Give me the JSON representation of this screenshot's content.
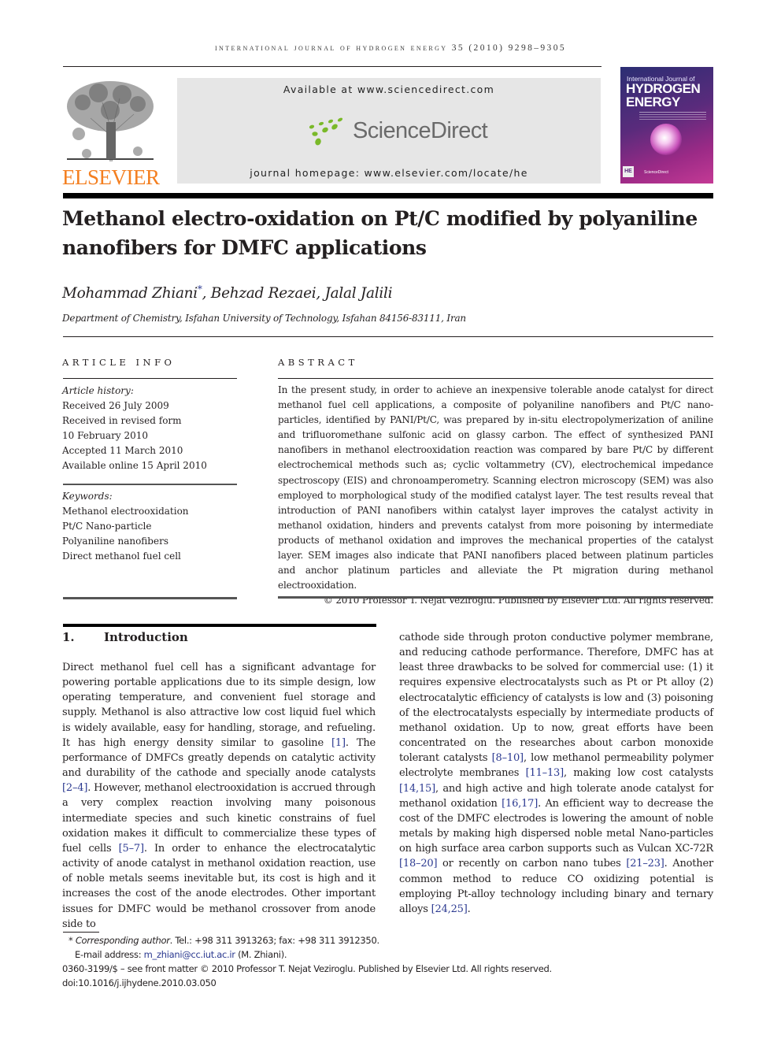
{
  "header": {
    "running_head": "INTERNATIONAL JOURNAL OF HYDROGEN ENERGY 35 (2010) 9298–9305",
    "publisher_logo_text": "ELSEVIER",
    "sciencedirect_available": "Available at www.sciencedirect.com",
    "sciencedirect_logo_text": "ScienceDirect",
    "journal_homepage": "journal homepage: www.elsevier.com/locate/he",
    "cover": {
      "line1": "International Journal of",
      "line2": "HYDROGEN",
      "line3": "ENERGY",
      "badge": "HE",
      "footer": "ScienceDirect"
    },
    "colors": {
      "elsevier_orange": "#f47f20",
      "sciencedirect_green": "#7ab929",
      "link_blue": "#2b3990"
    }
  },
  "article": {
    "title_line1": "Methanol electro-oxidation on Pt/C modified by polyaniline",
    "title_line2": "nanofibers for DMFC applications",
    "authors": [
      {
        "name": "Mohammad Zhiani",
        "mark": "*"
      },
      {
        "name": "Behzad Rezaei",
        "mark": ""
      },
      {
        "name": "Jalal Jalili",
        "mark": ""
      }
    ],
    "author_sep": ", ",
    "affiliation": "Department of Chemistry, Isfahan University of Technology, Isfahan 84156-83111, Iran"
  },
  "article_info": {
    "heading": "ARTICLE INFO",
    "history_label": "Article history:",
    "history": [
      "Received 26 July 2009",
      "Received in revised form",
      "10 February 2010",
      "Accepted 11 March 2010",
      "Available online 15 April 2010"
    ],
    "keywords_label": "Keywords:",
    "keywords": [
      "Methanol electrooxidation",
      "Pt/C Nano-particle",
      "Polyaniline nanofibers",
      "Direct methanol fuel cell"
    ]
  },
  "abstract": {
    "heading": "ABSTRACT",
    "text": "In the present study, in order to achieve an inexpensive tolerable anode catalyst for direct methanol fuel cell applications, a composite of polyaniline nanofibers and Pt/C nano-particles, identified by PANI/Pt/C, was prepared by in-situ electropolymerization of aniline and trifluoromethane sulfonic acid on glassy carbon. The effect of synthesized PANI nanofibers in methanol electrooxidation reaction was compared by bare Pt/C by different electrochemical methods such as; cyclic voltammetry (CV), electrochemical impedance spectroscopy (EIS) and chronoamperometry. Scanning electron microscopy (SEM) was also employed to morphological study of the modified catalyst layer. The test results reveal that introduction of PANI nanofibers within catalyst layer improves the catalyst activity in methanol oxidation, hinders and prevents catalyst from more poisoning by intermediate products of methanol oxidation and improves the mechanical properties of the catalyst layer. SEM images also indicate that PANI nanofibers placed between platinum particles and anchor platinum particles and alleviate the Pt migration during methanol electrooxidation.",
    "copyright": "© 2010 Professor T. Nejat Veziroglu. Published by Elsevier Ltd. All rights reserved."
  },
  "introduction": {
    "number": "1.",
    "heading": "Introduction",
    "left_segments": [
      {
        "t": "Direct methanol fuel cell has a significant advantage for powering portable applications due to its simple design, low operating temperature, and convenient fuel storage and supply. Methanol is also attractive low cost liquid fuel which is widely available, easy for handling, storage, and refueling. It has high energy density similar to gasoline "
      },
      {
        "ref": "[1]"
      },
      {
        "t": ". The performance of DMFCs greatly depends on catalytic activity and durability of the cathode and specially anode catalysts "
      },
      {
        "ref": "[2–4]"
      },
      {
        "t": ". However, methanol electrooxidation is accrued through a very complex reaction involving many poisonous intermediate species and such kinetic constrains of fuel oxidation makes it difficult to commercialize these types of fuel cells "
      },
      {
        "ref": "[5–7]"
      },
      {
        "t": ". In order to enhance the electrocatalytic activity of anode catalyst in methanol oxidation reaction, use of noble metals seems inevitable but, its cost is high and it increases the cost of the anode electrodes. Other important issues for DMFC would be methanol crossover from anode side to"
      }
    ],
    "right_segments": [
      {
        "t": "cathode side through proton conductive polymer membrane, and reducing cathode performance. Therefore, DMFC has at least three drawbacks to be solved for commercial use: (1) it requires expensive electrocatalysts such as Pt or Pt alloy (2) electrocatalytic efficiency of catalysts is low and (3) poisoning of the electrocatalysts especially by intermediate products of methanol oxidation. Up to now, great efforts have been concentrated on the researches about carbon monoxide tolerant catalysts "
      },
      {
        "ref": "[8–10]"
      },
      {
        "t": ", low methanol permeability polymer electrolyte membranes "
      },
      {
        "ref": "[11–13]"
      },
      {
        "t": ", making low cost catalysts "
      },
      {
        "ref": "[14,15]"
      },
      {
        "t": ", and high active and high tolerate anode catalyst for methanol oxidation "
      },
      {
        "ref": "[16,17]"
      },
      {
        "t": ". An efficient way to decrease the cost of the DMFC electrodes is lowering the amount of noble metals by making high dispersed noble metal Nano-particles on high surface area carbon supports such as Vulcan XC-72R "
      },
      {
        "ref": "[18–20]"
      },
      {
        "t": " or recently on carbon nano tubes "
      },
      {
        "ref": "[21–23]"
      },
      {
        "t": ". Another common method to reduce CO oxidizing potential is employing Pt-alloy technology including binary and ternary alloys "
      },
      {
        "ref": "[24,25]"
      },
      {
        "t": "."
      }
    ]
  },
  "footnotes": {
    "star": "*",
    "corresponding_label": "Corresponding author",
    "contact": ". Tel.: +98 311 3913263; fax: +98 311 3912350.",
    "email_label": "E-mail address: ",
    "email": "m_zhiani@cc.iut.ac.ir",
    "email_suffix": " (M. Zhiani).",
    "front_matter": "0360-3199/$ – see front matter © 2010 Professor T. Nejat Veziroglu. Published by Elsevier Ltd. All rights reserved.",
    "doi": "doi:10.1016/j.ijhydene.2010.03.050"
  }
}
